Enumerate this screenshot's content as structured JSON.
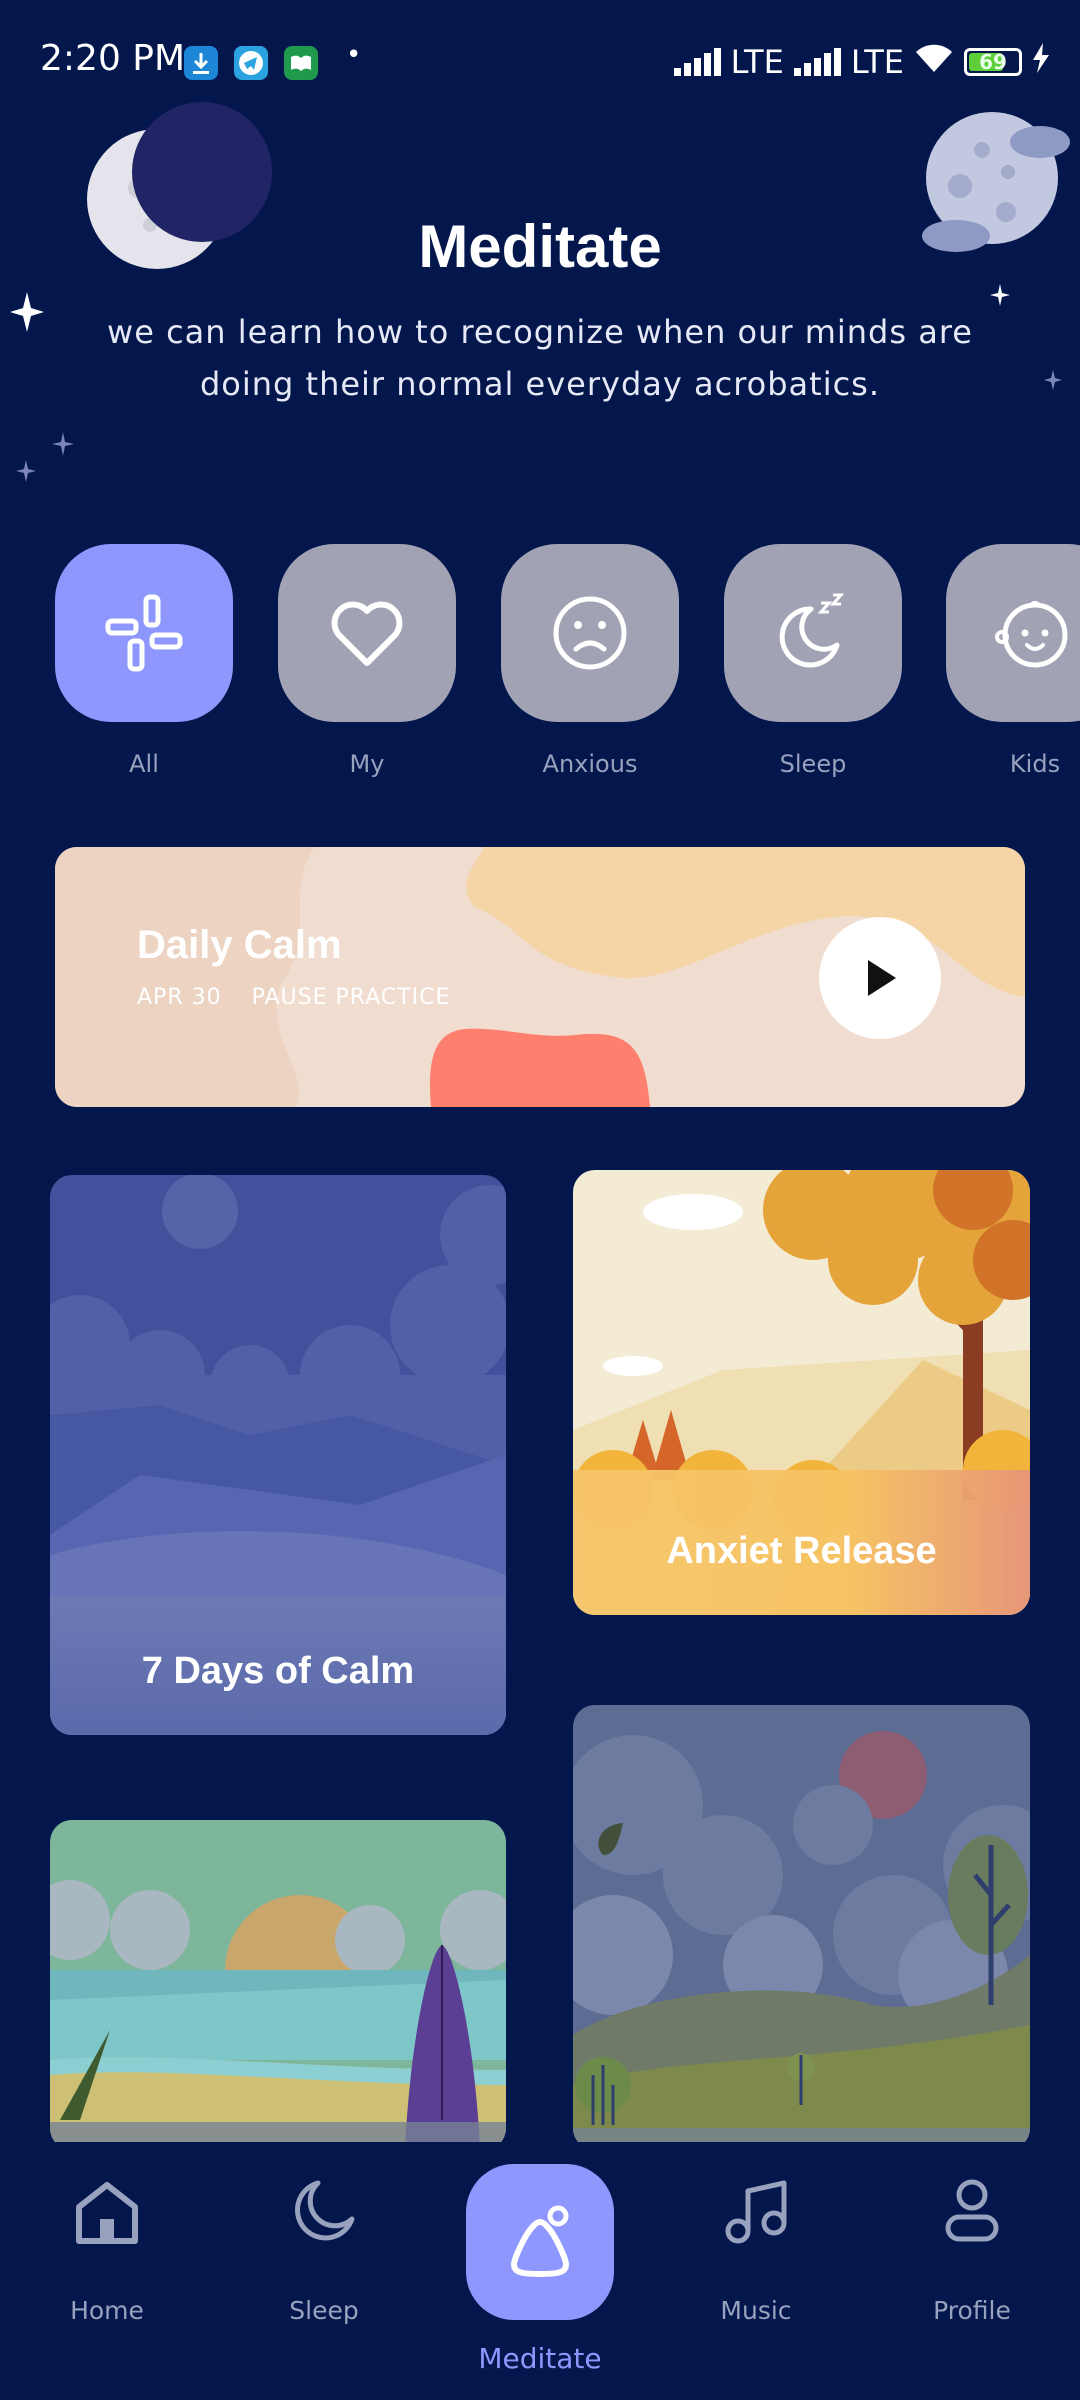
{
  "status_bar": {
    "time": "2:20 PM",
    "dot": "•",
    "network_1": "LTE",
    "network_2": "LTE",
    "battery": "69"
  },
  "header": {
    "title": "Meditate",
    "subtitle": "we can learn how to recognize when our minds are doing their normal everyday acrobatics."
  },
  "categories": [
    {
      "label": "All",
      "icon": "grid-icon",
      "active": true
    },
    {
      "label": "My",
      "icon": "heart-icon",
      "active": false
    },
    {
      "label": "Anxious",
      "icon": "sad-face-icon",
      "active": false
    },
    {
      "label": "Sleep",
      "icon": "moon-zzz-icon",
      "active": false
    },
    {
      "label": "Kids",
      "icon": "baby-face-icon",
      "active": false
    }
  ],
  "daily_calm": {
    "title": "Daily Calm",
    "date": "APR 30",
    "subtitle": "PAUSE PRACTICE"
  },
  "cards": [
    {
      "title": "7 Days of Calm"
    },
    {
      "title": "Anxiet Release"
    },
    {
      "title": ""
    },
    {
      "title": ""
    }
  ],
  "nav": {
    "home": "Home",
    "sleep": "Sleep",
    "meditate": "Meditate",
    "music": "Music",
    "profile": "Profile"
  },
  "colors": {
    "background": "#03174C",
    "accent": "#8E97FD",
    "inactive": "#A2A2B5",
    "label": "#98A1BD"
  }
}
